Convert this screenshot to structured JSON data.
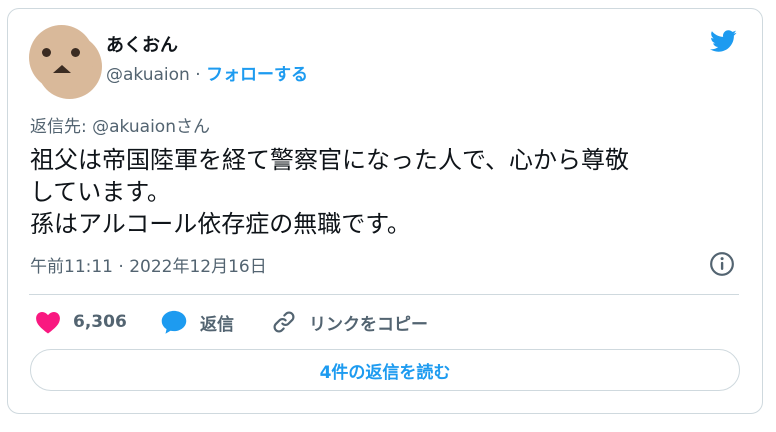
{
  "author": {
    "display_name": "あくおん",
    "handle": "@akuaion",
    "separator": " · ",
    "follow_label": "フォローする"
  },
  "reply_to": {
    "prefix": "返信先: ",
    "handle": "@akuaion",
    "suffix": "さん"
  },
  "tweet": {
    "lines": [
      "祖父は帝国陸軍を経て警察官になった人で、心から尊敬",
      "しています。",
      "孫はアルコール依存症の無職です。"
    ],
    "timestamp": "午前11:11 · 2022年12月16日"
  },
  "actions": {
    "likes_count": "6,306",
    "reply_label": "返信",
    "copy_link_label": "リンクをコピー"
  },
  "read_replies_label": "4件の返信を読む",
  "colors": {
    "accent": "#1d9bf0",
    "like": "#f91880",
    "secondary_text": "#536471",
    "border": "#cfd9de"
  },
  "icons": [
    "twitter-bird-icon",
    "info-icon",
    "heart-icon",
    "reply-bubble-icon",
    "link-icon"
  ]
}
